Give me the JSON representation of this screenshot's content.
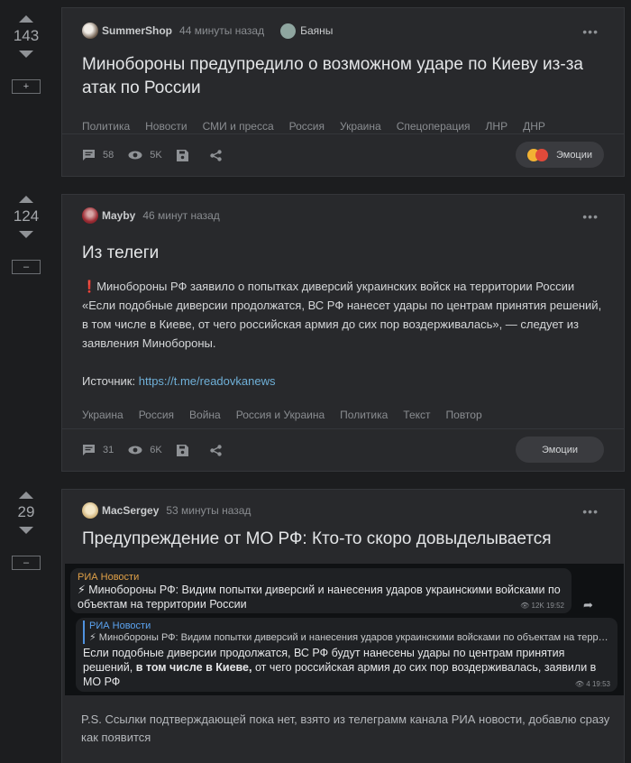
{
  "posts": [
    {
      "rating": "143",
      "collapse": "+",
      "author": "SummerShop",
      "time": "44 минуты назад",
      "community": "Баяны",
      "title": "Минобороны предупредило о возможном ударе по Киеву из-за атак по России",
      "tags": [
        "Политика",
        "Новости",
        "СМИ и пресса",
        "Россия",
        "Украина",
        "Спецоперация",
        "ЛНР",
        "ДНР"
      ],
      "comments": "58",
      "views": "5K",
      "emotions": "Эмоции"
    },
    {
      "rating": "124",
      "collapse": "–",
      "author": "Mayby",
      "time": "46 минут назад",
      "title": "Из телеги",
      "bang": "❗",
      "body": "Минобороны РФ заявило о попытках диверсий украинских войск на территории России «Если подобные диверсии продолжатся, ВС РФ нанесет удары по центрам принятия решений, в том числе в Киеве, от чего российская армия до сих пор воздерживалась», — следует из заявления Минобороны.",
      "source_label": "Источник:",
      "source_link": "https://t.me/readovkanews",
      "tags": [
        "Украина",
        "Россия",
        "Война",
        "Россия и Украина",
        "Политика",
        "Текст",
        "Повтор"
      ],
      "comments": "31",
      "views": "6K",
      "emotions": "Эмоции"
    },
    {
      "rating": "29",
      "collapse": "–",
      "author": "MacSergey",
      "time": "53 минуты назад",
      "title": "Предупреждение от МО РФ: Кто-то скоро довыделывается",
      "tg1": {
        "channel": "РИА Новости",
        "text": "⚡ Минобороны РФ: Видим попытки диверсий и нанесения ударов украинскими войсками по объектам на территории России",
        "meta": "👁 12K 19:52"
      },
      "tg2": {
        "quote_channel": "РИА Новости",
        "quote_text": "⚡ Минобороны РФ: Видим попытки диверсий и нанесения ударов украинскими войсками по объектам на территори…",
        "text_a": "Если подобные диверсии продолжатся, ВС РФ будут нанесены удары по центрам принятия решений, ",
        "text_bold": "в том числе в Киеве,",
        "text_b": " от чего российская армия до сих пор воздерживалась, заявили в МО РФ",
        "meta": "👁 4 19:53"
      },
      "ps": "P.S. Ссылки подтверждающей пока нет, взято из телеграмм канала РИА новости, добавлю сразу как появится"
    }
  ],
  "menu_dots": "•••",
  "share_glyph": "➦"
}
